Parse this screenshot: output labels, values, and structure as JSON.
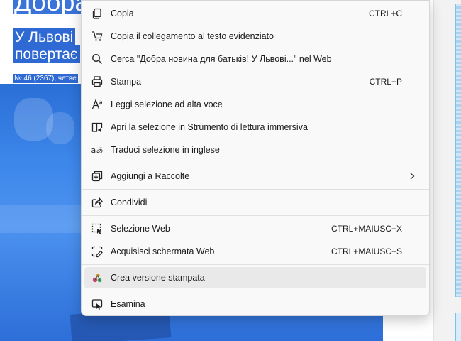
{
  "background": {
    "title": "Добра",
    "subtitle_line1": "У Львові",
    "subtitle_line2": "повертає",
    "meta": "№ 46 (2367), четве"
  },
  "menu": {
    "items": [
      {
        "label": "Copia",
        "shortcut": "CTRL+C",
        "icon": "copy-icon"
      },
      {
        "label": "Copia il collegamento al testo evidenziato",
        "shortcut": "",
        "icon": "link-cart-icon"
      },
      {
        "label": "Cerca \"Добра новина для батьків! У Львові...\" nel Web",
        "shortcut": "",
        "icon": "search-icon"
      },
      {
        "label": "Stampa",
        "shortcut": "CTRL+P",
        "icon": "printer-icon"
      },
      {
        "label": "Leggi selezione ad alta voce",
        "shortcut": "",
        "icon": "read-aloud-icon"
      },
      {
        "label": "Apri la selezione in Strumento di lettura immersiva",
        "shortcut": "",
        "icon": "immersive-reader-icon"
      },
      {
        "label": "Traduci selezione in inglese",
        "shortcut": "",
        "icon": "translate-icon"
      },
      {
        "label": "Aggiungi a Raccolte",
        "shortcut": "",
        "icon": "collections-icon",
        "submenu": true
      },
      {
        "label": "Condividi",
        "shortcut": "",
        "icon": "share-icon"
      },
      {
        "label": "Selezione Web",
        "shortcut": "CTRL+MAIUSC+X",
        "icon": "web-select-icon"
      },
      {
        "label": "Acquisisci schermata Web",
        "shortcut": "CTRL+MAIUSC+S",
        "icon": "screenshot-icon"
      },
      {
        "label": "Crea versione stampata",
        "shortcut": "",
        "icon": "print-version-icon"
      },
      {
        "label": "Esamina",
        "shortcut": "",
        "icon": "inspect-icon"
      }
    ]
  },
  "colors": {
    "menu_bg": "#f9f9f9",
    "highlight": "#e9e9e9",
    "page_blue": "#3b80e6"
  }
}
